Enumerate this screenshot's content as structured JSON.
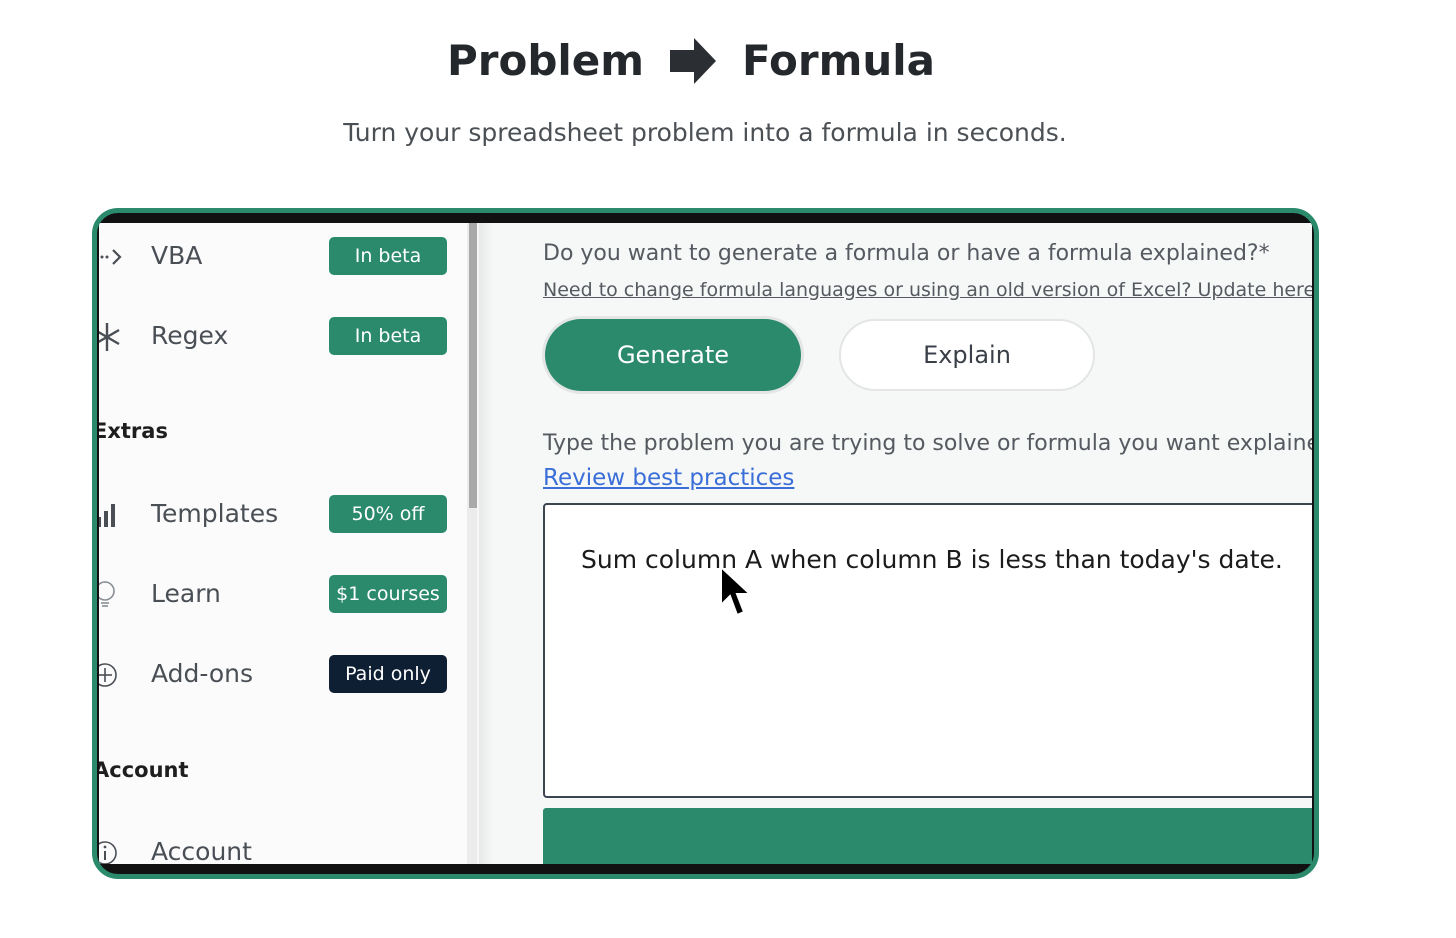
{
  "hero": {
    "title_left": "Problem",
    "title_right": "Formula",
    "subtitle": "Turn your spreadsheet problem into a formula in seconds."
  },
  "sidebar": {
    "items_top": [
      {
        "label": "VBA",
        "badge": "In beta",
        "icon": "code-arrow-icon"
      },
      {
        "label": "Regex",
        "badge": "In beta",
        "icon": "asterisk-icon"
      }
    ],
    "extras_heading": "Extras",
    "extras": [
      {
        "label": "Templates",
        "badge": "50% off",
        "icon": "bar-chart-icon"
      },
      {
        "label": "Learn",
        "badge": "$1 courses",
        "icon": "lightbulb-icon"
      },
      {
        "label": "Add-ons",
        "badge": "Paid only",
        "icon": "plus-circle-icon"
      }
    ],
    "account_heading": "Account",
    "account": [
      {
        "label": "Account",
        "icon": "info-circle-icon"
      }
    ]
  },
  "main": {
    "question": "Do you want to generate a formula or have a formula explained?*",
    "change_link": "Need to change formula languages or using an old version of Excel? Update here",
    "generate_label": "Generate",
    "explain_label": "Explain",
    "type_label": "Type the problem you are trying to solve or formula you want explained",
    "review_link": "Review best practices",
    "input_value": "Sum column A when column B is less than today's date."
  },
  "colors": {
    "accent": "#2a8a6b",
    "dark_badge": "#0e1f33",
    "link": "#3b6fd8"
  }
}
